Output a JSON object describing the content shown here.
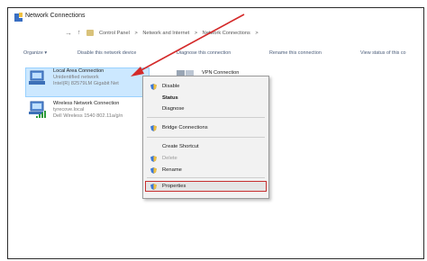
{
  "window": {
    "title": "Network Connections"
  },
  "breadcrumb": [
    "Control Panel",
    ">",
    "Network and Internet",
    ">",
    "Network Connections",
    ">"
  ],
  "toolbar": {
    "organize": "Organize ▾",
    "disable": "Disable this network device",
    "diagnose": "Diagnose this connection",
    "rename": "Rename this connection",
    "view_status": "View status of this co"
  },
  "connections": [
    {
      "name": "Local Area Connection",
      "line2": "Unidentified network",
      "line3": "Intel(R) 82579LM Gigabit Net"
    },
    {
      "name": "Wireless Network Connection",
      "line2": "tyrecove.local",
      "line3": "Dell Wireless 1540 802.11a/g/n"
    },
    {
      "name": "VPN Connection"
    }
  ],
  "context_menu": {
    "disable": "Disable",
    "status": "Status",
    "diagnose": "Diagnose",
    "bridge": "Bridge Connections",
    "shortcut": "Create Shortcut",
    "delete": "Delete",
    "rename": "Rename",
    "properties": "Properties"
  },
  "colors": {
    "annotation_red": "#d42a2a",
    "selection_blue": "#cce8ff"
  }
}
